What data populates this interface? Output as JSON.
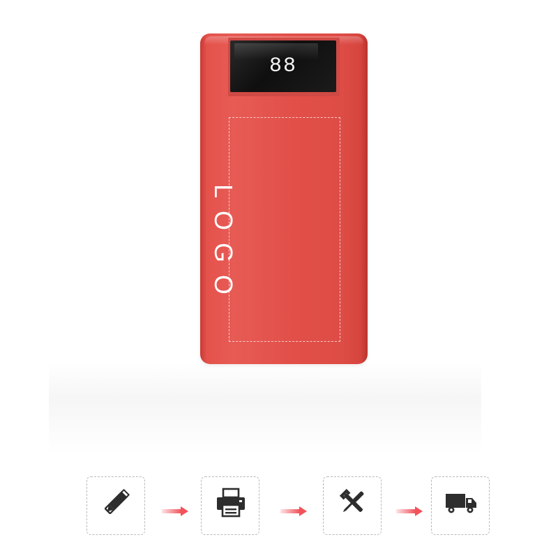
{
  "product": {
    "display_readout": "88",
    "logo_placeholder": "LOGO",
    "body_color": "#e2504a",
    "display_color": "#141414"
  },
  "process_steps": [
    {
      "icon": "design-pencil-ruler-icon"
    },
    {
      "icon": "printer-icon"
    },
    {
      "icon": "tools-icon"
    },
    {
      "icon": "delivery-truck-icon"
    }
  ],
  "colors": {
    "arrow": "#f2525a",
    "icon": "#2d2d2d",
    "card_border": "#b9b9b9"
  }
}
